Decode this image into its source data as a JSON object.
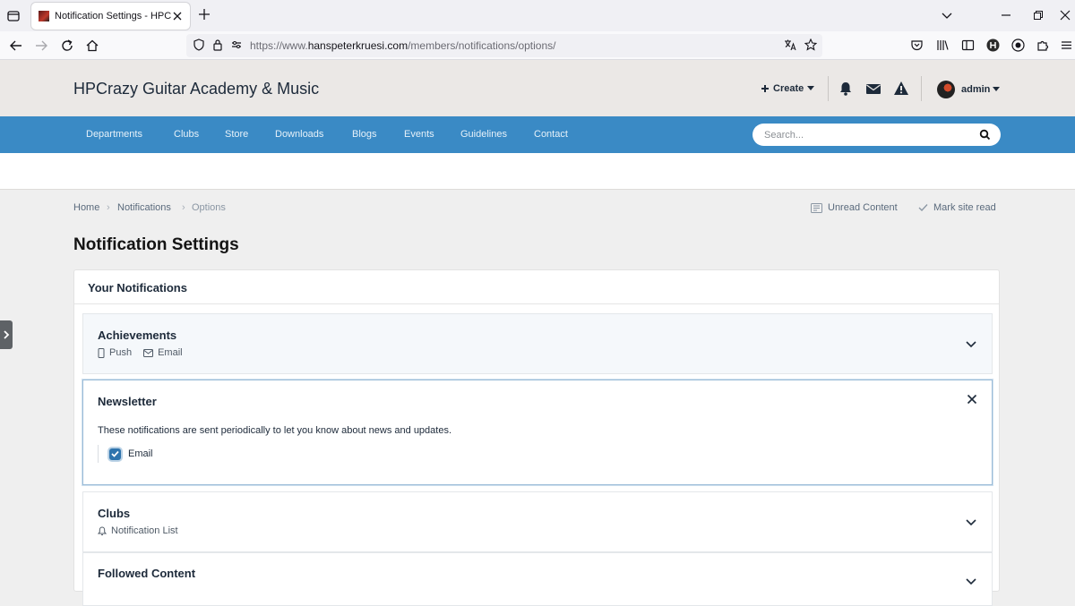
{
  "browser": {
    "tab_title": "Notification Settings - HPCrazy",
    "url_prefix": "https://www.",
    "url_domain": "hanspeterkruesi.com",
    "url_path": "/members/notifications/options/"
  },
  "site": {
    "title": "HPCrazy Guitar Academy & Music",
    "create_label": "Create",
    "user_name": "admin"
  },
  "nav": {
    "items": [
      "Departments",
      "Clubs",
      "Store",
      "Downloads",
      "Blogs",
      "Events",
      "Guidelines",
      "Contact"
    ],
    "search_placeholder": "Search..."
  },
  "breadcrumb": {
    "items": [
      "Home",
      "Notifications",
      "Options"
    ],
    "unread": "Unread Content",
    "mark_read": "Mark site read"
  },
  "page": {
    "title": "Notification Settings",
    "panel_title": "Your Notifications",
    "achievements": {
      "title": "Achievements",
      "meta1": "Push",
      "meta2": "Email"
    },
    "newsletter": {
      "title": "Newsletter",
      "description": "These notifications are sent periodically to let you know about news and updates.",
      "email_label": "Email",
      "email_checked": true
    },
    "clubs": {
      "title": "Clubs",
      "meta": "Notification List"
    },
    "followed": {
      "title": "Followed Content"
    }
  },
  "colors": {
    "nav_blue": "#3a8ac5",
    "header_bg": "#ebe8e6",
    "checkbox": "#2f74ad"
  }
}
